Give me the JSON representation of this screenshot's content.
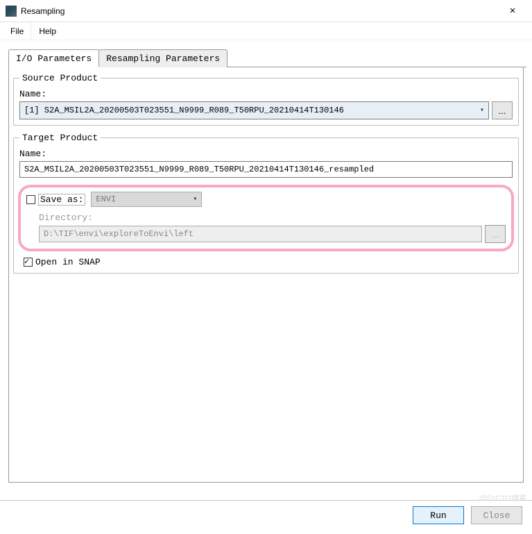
{
  "window": {
    "title": "Resampling",
    "close_symbol": "×"
  },
  "menu": {
    "file": "File",
    "help": "Help"
  },
  "tabs": {
    "io": "I/O Parameters",
    "resampling": "Resampling Parameters"
  },
  "source": {
    "legend": "Source Product",
    "name_label": "Name:",
    "selected": "[1] S2A_MSIL2A_20200503T023551_N9999_R089_T50RPU_20210414T130146",
    "browse": "..."
  },
  "target": {
    "legend": "Target Product",
    "name_label": "Name:",
    "name_value": "S2A_MSIL2A_20200503T023551_N9999_R089_T50RPU_20210414T130146_resampled",
    "saveas_label": "Save as:",
    "format": "ENVI",
    "directory_label": "Directory:",
    "directory_value": "D:\\TIF\\envi\\exploreToEnvi\\left",
    "browse": "...",
    "open_in_snap": "Open in SNAP"
  },
  "buttons": {
    "run": "Run",
    "close": "Close"
  },
  "watermark": "@51CTO博客"
}
